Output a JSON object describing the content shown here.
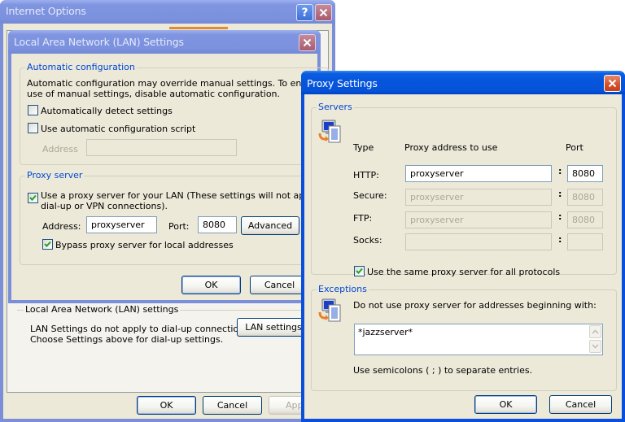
{
  "internet_options": {
    "title": "Internet Options",
    "help_icon": "?",
    "close_icon": "close-x",
    "lan_group_label": "Local Area Network (LAN) settings",
    "lan_note_line1": "LAN Settings do not apply to dial-up connections.",
    "lan_note_line2": "Choose Settings above for dial-up settings.",
    "lan_settings_button": "LAN settings",
    "ok_button": "OK",
    "cancel_button": "Cancel",
    "apply_button": "Apply",
    "selected_tab_accent": "#e68b2c"
  },
  "lan_settings": {
    "title": "Local Area Network (LAN) Settings",
    "auto_config": {
      "group_label": "Automatic configuration",
      "description_line1": "Automatic configuration may override manual settings.  To ensure the",
      "description_line2": "use of manual settings, disable automatic configuration.",
      "auto_detect_label": "Automatically detect settings",
      "auto_detect_checked": false,
      "use_script_label": "Use automatic configuration script",
      "use_script_checked": false,
      "address_label": "Address",
      "address_value": ""
    },
    "proxy_server": {
      "group_label": "Proxy server",
      "use_proxy_line1": "Use a proxy server for your LAN (These settings will not apply to",
      "use_proxy_line2": "dial-up or VPN connections).",
      "use_proxy_checked": true,
      "address_label": "Address:",
      "address_value": "proxyserver",
      "port_label": "Port:",
      "port_value": "8080",
      "advanced_button": "Advanced",
      "bypass_label": "Bypass proxy server for local addresses",
      "bypass_checked": true
    },
    "ok_button": "OK",
    "cancel_button": "Cancel"
  },
  "proxy_settings": {
    "title": "Proxy Settings",
    "servers": {
      "group_label": "Servers",
      "col_type": "Type",
      "col_address": "Proxy address to use",
      "col_port": "Port",
      "rows": [
        {
          "type": "HTTP:",
          "address": "proxyserver",
          "port": "8080",
          "enabled": true
        },
        {
          "type": "Secure:",
          "address": "proxyserver",
          "port": "8080",
          "enabled": false
        },
        {
          "type": "FTP:",
          "address": "proxyserver",
          "port": "8080",
          "enabled": false
        },
        {
          "type": "Socks:",
          "address": "",
          "port": "",
          "enabled": false
        }
      ],
      "separator": ":",
      "same_proxy_label": "Use the same proxy server for all protocols",
      "same_proxy_checked": true
    },
    "exceptions": {
      "group_label": "Exceptions",
      "description": "Do not use proxy server for addresses beginning with:",
      "value": "*jazzserver*",
      "hint": "Use semicolons ( ; ) to separate entries."
    },
    "ok_button": "OK",
    "cancel_button": "Cancel"
  }
}
